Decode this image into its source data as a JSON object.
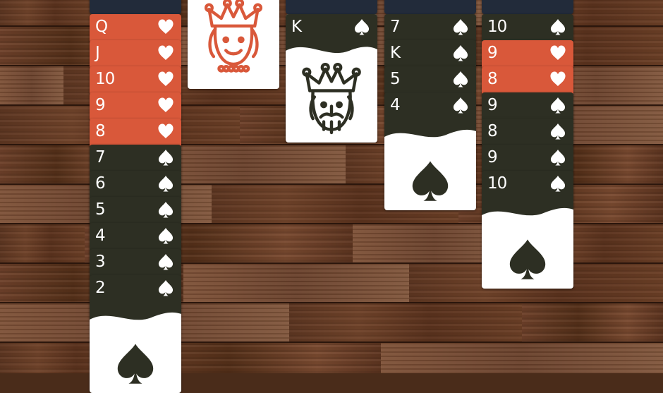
{
  "colors": {
    "card_dark": "#2d2f23",
    "card_red": "#d9583a",
    "card_back": "#222b3a",
    "card_face": "#ffffff"
  },
  "tableau": [
    {
      "pile": 1,
      "cards": [
        {
          "rank": "Q",
          "suit": "hearts"
        },
        {
          "rank": "J",
          "suit": "hearts"
        },
        {
          "rank": "10",
          "suit": "hearts"
        },
        {
          "rank": "9",
          "suit": "hearts"
        },
        {
          "rank": "8",
          "suit": "hearts"
        },
        {
          "rank": "7",
          "suit": "spades"
        },
        {
          "rank": "6",
          "suit": "spades"
        },
        {
          "rank": "5",
          "suit": "spades"
        },
        {
          "rank": "4",
          "suit": "spades"
        },
        {
          "rank": "3",
          "suit": "spades"
        },
        {
          "rank": "2",
          "suit": "spades"
        }
      ]
    },
    {
      "pile": 2,
      "cards": [
        {
          "rank": "Q",
          "suit": "hearts",
          "face_icon": "queen-face-icon"
        }
      ]
    },
    {
      "pile": 3,
      "cards": [
        {
          "rank": "K",
          "suit": "spades",
          "face_icon": "king-face-icon"
        }
      ]
    },
    {
      "pile": 4,
      "cards": [
        {
          "rank": "7",
          "suit": "spades"
        },
        {
          "rank": "K",
          "suit": "spades"
        },
        {
          "rank": "5",
          "suit": "spades"
        },
        {
          "rank": "4",
          "suit": "spades"
        }
      ]
    },
    {
      "pile": 5,
      "cards": [
        {
          "rank": "10",
          "suit": "spades"
        },
        {
          "rank": "9",
          "suit": "hearts"
        },
        {
          "rank": "8",
          "suit": "hearts"
        },
        {
          "rank": "9",
          "suit": "spades"
        },
        {
          "rank": "8",
          "suit": "spades"
        },
        {
          "rank": "9",
          "suit": "spades"
        },
        {
          "rank": "10",
          "suit": "spades"
        }
      ]
    }
  ]
}
